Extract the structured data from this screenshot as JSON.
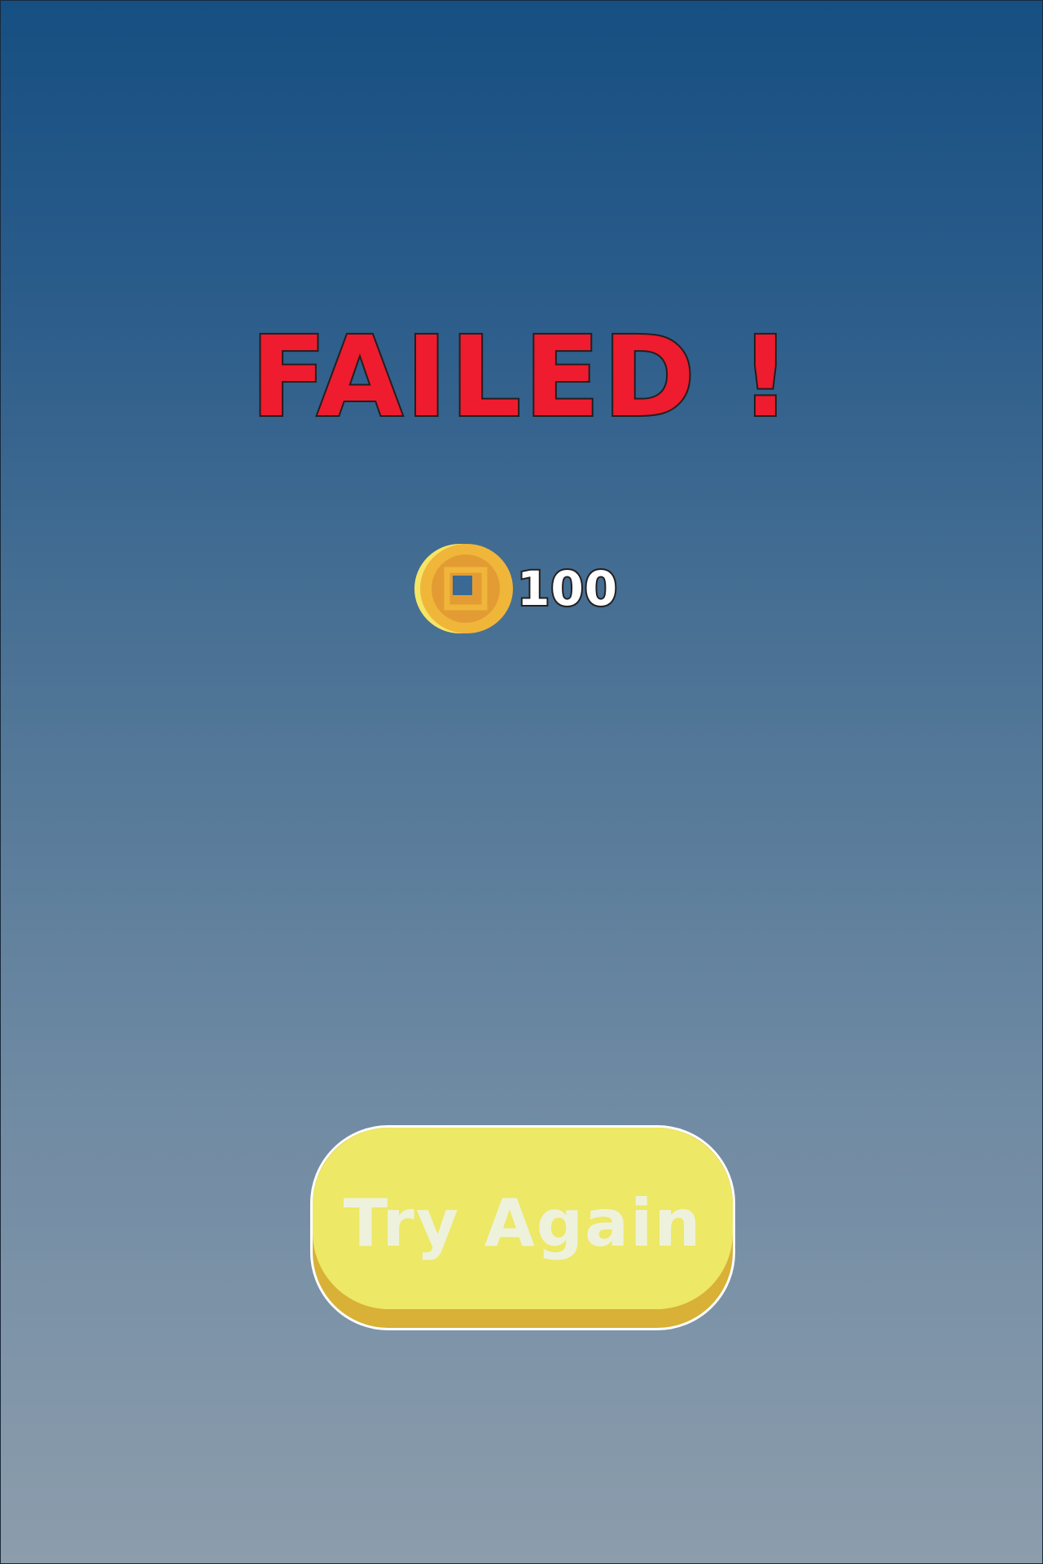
{
  "result": {
    "title": "FAILED !"
  },
  "reward": {
    "icon": "coin-icon",
    "count": "100"
  },
  "actions": {
    "retry_label": "Try Again"
  },
  "colors": {
    "title_fill": "#ee1c2e",
    "outline": "#231f20",
    "button_face": "#ede866",
    "button_base": "#d8b136",
    "button_text": "#eef2dc",
    "coin_gold": "#f0b63a",
    "coin_inner": "#e39c34",
    "background_top": "#164f82",
    "background_bottom": "#8c9dac"
  }
}
